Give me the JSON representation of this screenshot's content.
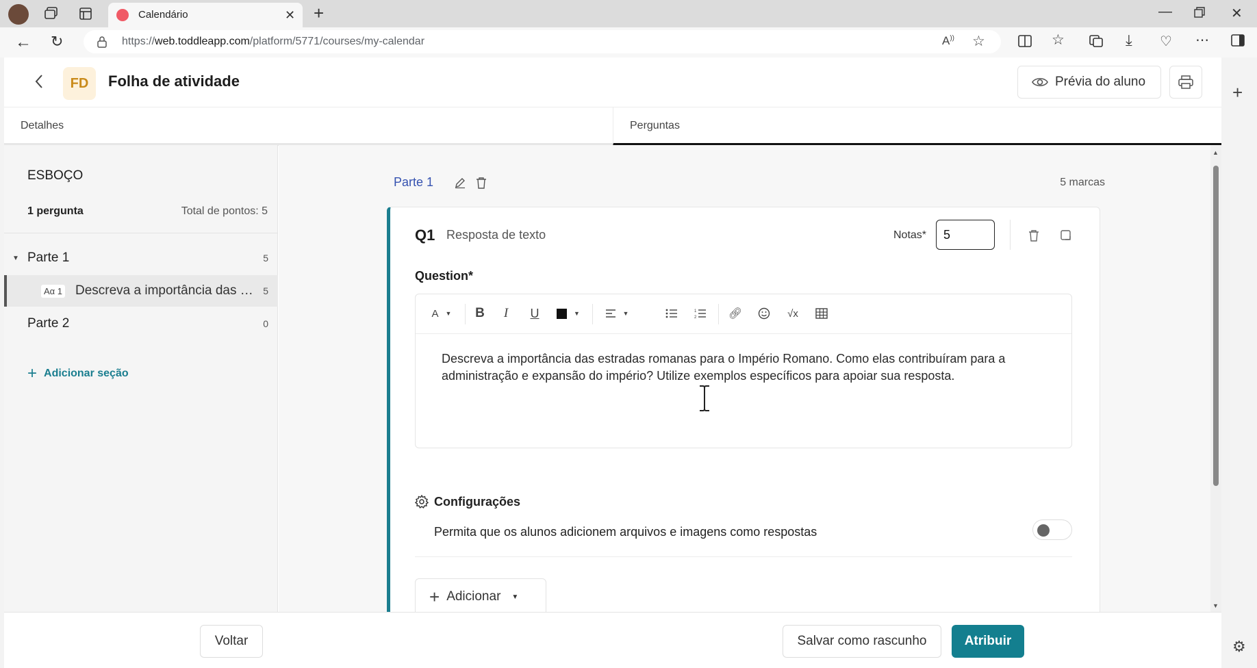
{
  "browser": {
    "tab_title": "Calendário",
    "url_prefix": "https://",
    "url_domain": "web.toddleapp.com",
    "url_path": "/platform/5771/courses/my-calendar"
  },
  "header": {
    "avatar_initials": "FD",
    "title": "Folha de atividade",
    "preview_label": "Prévia do aluno"
  },
  "tabs": [
    {
      "label": "Detalhes",
      "active": false
    },
    {
      "label": "Perguntas",
      "active": true
    }
  ],
  "sidebar": {
    "title": "ESBOÇO",
    "question_count": "1 pergunta",
    "total_points": "Total de pontos: 5",
    "parts": [
      {
        "label": "Parte 1",
        "points": "5"
      },
      {
        "label": "Parte 2",
        "points": "0"
      }
    ],
    "question_item": {
      "badge": "Aα 1",
      "text": "Descreva a importância das estradas romanas para o Império Romano",
      "points": "5"
    },
    "add_section": "Adicionar seção"
  },
  "main": {
    "part_title": "Parte 1",
    "part_marks": "5 marcas",
    "question": {
      "number": "Q1",
      "type": "Resposta de texto",
      "notas_label": "Notas*",
      "notas_value": "5",
      "question_label": "Question*",
      "text": "Descreva a importância das estradas romanas para o Império Romano. Como elas contribuíram para a administração e expansão do império? Utilize exemplos específicos para apoiar sua resposta.",
      "settings_title": "Configurações",
      "settings_option": "Permita que os alunos adicionem arquivos e imagens como respostas",
      "settings_enabled": false,
      "add_label": "Adicionar"
    }
  },
  "footer": {
    "back_label": "Voltar",
    "draft_label": "Salvar como rascunho",
    "assign_label": "Atribuir"
  },
  "colors": {
    "accent": "#137f8f",
    "part_title": "#3552b0",
    "avatar_bg": "#fdf1dc"
  }
}
